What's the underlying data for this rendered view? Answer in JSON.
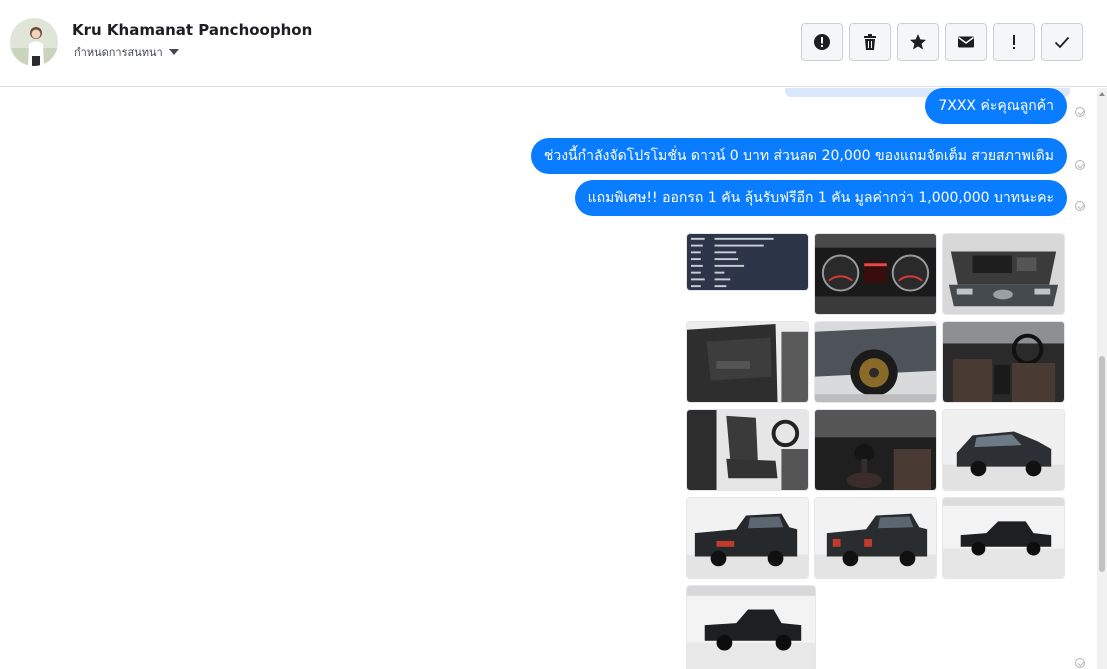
{
  "header": {
    "contact_name": "Kru Khamanat Panchoophon",
    "conversation_menu_label": "กำหนดการสนทนา"
  },
  "toolbar": {
    "buttons": [
      "alert-circle-icon",
      "trash-icon",
      "star-icon",
      "mail-icon",
      "exclamation-icon",
      "check-icon"
    ]
  },
  "messages": [
    {
      "text": "7XXX ค่ะคุณลูกค้า",
      "status": "sent"
    },
    {
      "text": "ช่วงนี้กำลังจัดโปรโมชั่น ดาวน์ 0 บาท ส่วนลด 20,000 ของแถมจัดเต็ม สวยสภาพเดิม",
      "status": "sent"
    },
    {
      "text": "แถมพิเศษ!! ออกรถ 1 คัน ลุ้นรับฟรีอีก 1 คัน มูลค่ากว่า 1,000,000 บาทนะคะ",
      "status": "sent"
    }
  ],
  "photo_gallery": {
    "photos": [
      "registration-document-photo",
      "dashboard-gauges-photo",
      "engine-bay-photo",
      "door-interior-photo",
      "front-wheel-photo",
      "cabin-interior-photo",
      "front-seat-photo",
      "gear-shift-photo",
      "front-three-quarter-photo",
      "rear-three-quarter-photo",
      "rear-view-photo",
      "side-profile-photo",
      "side-view-photo"
    ]
  },
  "colors": {
    "bubble": "#0a7cff",
    "bubble_text": "#ffffff",
    "background": "#ffffff",
    "divider": "#dddfe2"
  }
}
